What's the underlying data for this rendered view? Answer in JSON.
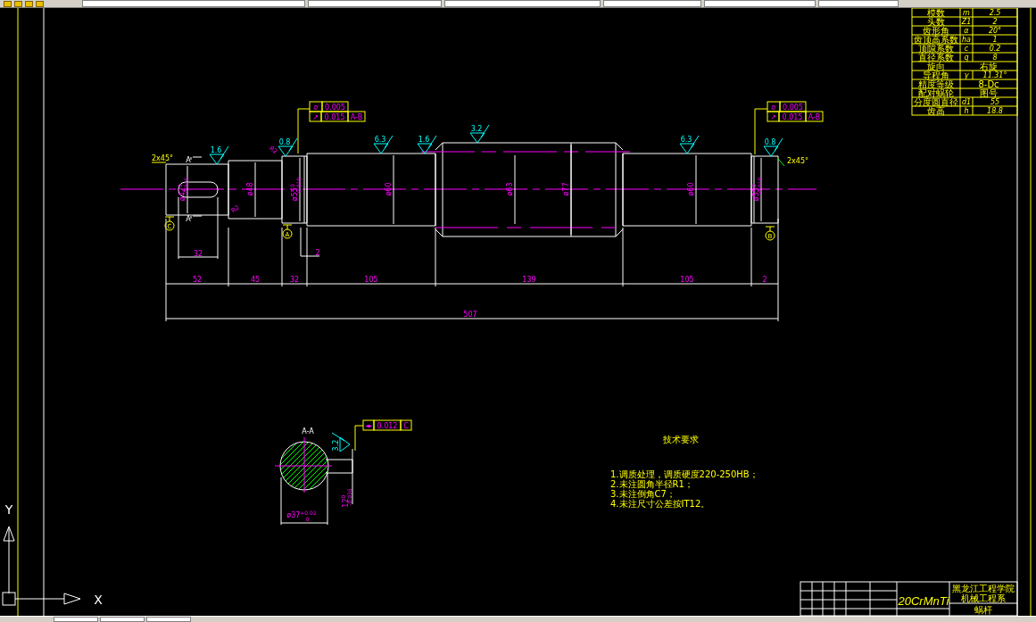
{
  "param_table": {
    "rows": [
      {
        "label": "模数",
        "symbol": "m",
        "value": "2.5"
      },
      {
        "label": "头数",
        "symbol": "Z1",
        "value": "2"
      },
      {
        "label": "齿形角",
        "symbol": "α",
        "value": "20°"
      },
      {
        "label": "齿顶高系数",
        "symbol": "ha",
        "value": "1"
      },
      {
        "label": "顶隙系数",
        "symbol": "c",
        "value": "0.2"
      },
      {
        "label": "直径系数",
        "symbol": "q",
        "value": "8"
      },
      {
        "label": "旋向",
        "value": "右旋"
      },
      {
        "label": "导程角",
        "symbol": "γ",
        "value": "11.31°"
      },
      {
        "label": "精度等级",
        "value": "8-Dc"
      },
      {
        "label": "配对蜗轮",
        "value": "图号"
      },
      {
        "label": "分度圆直径",
        "symbol": "d1",
        "value": "55"
      },
      {
        "label": "齿高",
        "symbol": "h",
        "value": "18.8"
      }
    ]
  },
  "shaft": {
    "chamfer_labels": [
      "2x45°",
      "2x45°"
    ],
    "section_marks": [
      "A",
      "A"
    ],
    "fillet_labels": [
      "R2",
      "R2"
    ],
    "diameters": [
      {
        "nominal": "ø42",
        "upper": "0",
        "lower": "-0.016"
      },
      {
        "nominal": "ø48"
      },
      {
        "nominal": "ø55",
        "upper": "0",
        "lower": "-0.019"
      },
      {
        "nominal": "ø60"
      },
      {
        "nominal": "ø63"
      },
      {
        "nominal": "ø77"
      },
      {
        "nominal": "ø60"
      },
      {
        "nominal": "ø55",
        "upper": "0",
        "lower": "-0.019"
      }
    ],
    "lengths": [
      "52",
      "45",
      "32",
      "105",
      "139",
      "105",
      "2"
    ],
    "gap": "2",
    "keyway_length": "32",
    "overall": "507",
    "roughness": [
      "1.6",
      "0.8",
      "6.3",
      "1.6",
      "3.2",
      "6.3",
      "0.8"
    ],
    "tolerance_frames": [
      {
        "rows": [
          [
            "⌭",
            "0.005"
          ],
          [
            "↗",
            "0.015",
            "A-B"
          ]
        ]
      },
      {
        "rows": [
          [
            "⌭",
            "0.005"
          ],
          [
            "↗",
            "0.015",
            "A-B"
          ]
        ]
      }
    ],
    "datums": [
      "C",
      "A",
      "B"
    ]
  },
  "section": {
    "title": "A-A",
    "frame": [
      "⌯",
      "0.012",
      "C"
    ],
    "roughness": "3.2",
    "width": {
      "nominal": "ø37",
      "upper": "+0.02",
      "lower": "0"
    },
    "depth": {
      "nominal": "12",
      "upper": "0",
      "lower": "-0.036"
    }
  },
  "notes": {
    "title": "技术要求",
    "items": [
      "1.调质处理，调质硬度220-250HB；",
      "2.未注圆角半径R1；",
      "3.未注倒角C7；",
      "4.未注尺寸公差按IT12。"
    ]
  },
  "title_block": {
    "material": "20CrMnTi",
    "school": "黑龙江工程学院",
    "department": "机械工程系",
    "part": "蜗杆"
  },
  "ucs": {
    "x": "X",
    "y": "Y"
  }
}
